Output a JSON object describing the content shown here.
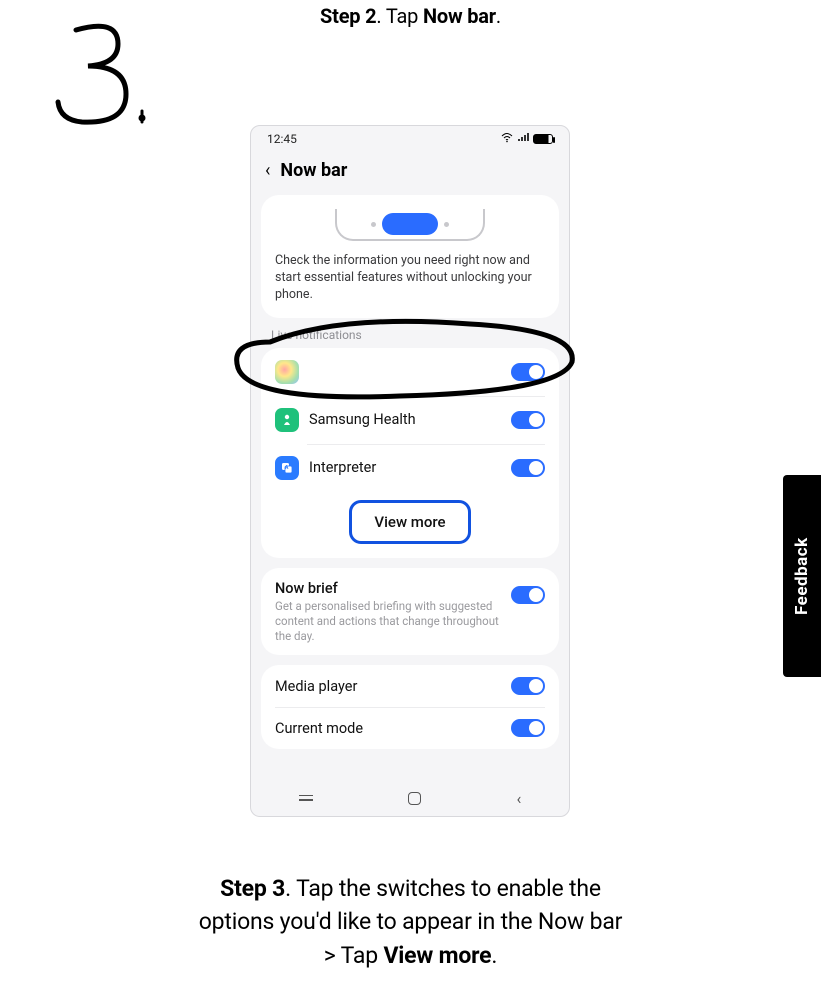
{
  "step2": {
    "prefix_bold": "Step 2",
    "mid": ". Tap ",
    "target_bold": "Now bar",
    "suffix": "."
  },
  "step3": {
    "prefix_bold": "Step 3",
    "line1_rest": ". Tap the switches to enable the",
    "line2": "options you'd like to appear in the Now bar",
    "line3_prefix": "> Tap ",
    "line3_bold": "View more",
    "line3_suffix": "."
  },
  "handwritten": "3.",
  "phone": {
    "status": {
      "time": "12:45"
    },
    "header": {
      "title": "Now bar"
    },
    "preview_text": "Check the information you need right now and start essential features without unlocking your phone.",
    "section_label": "Live notifications",
    "rows": {
      "r1_label": "",
      "r2_label": "Samsung Health",
      "r3_label": "Interpreter"
    },
    "view_more": "View more",
    "now_brief": {
      "title": "Now brief",
      "sub": "Get a personalised briefing with suggested content and actions that change throughout the day."
    },
    "rows2": {
      "media": "Media player",
      "mode": "Current mode"
    }
  },
  "feedback": "Feedback"
}
